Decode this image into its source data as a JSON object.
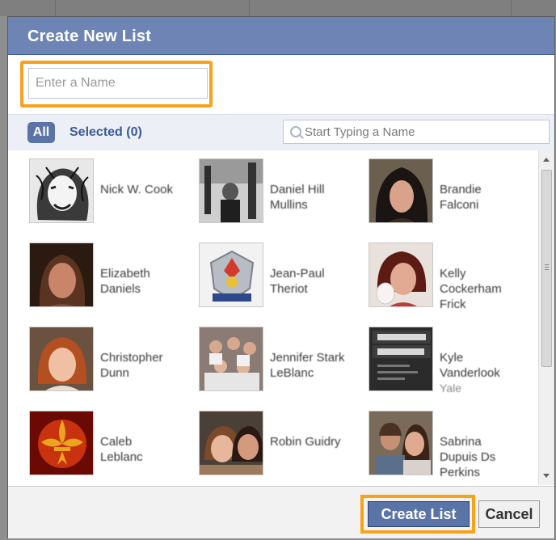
{
  "dialog": {
    "title": "Create New List",
    "name_placeholder": "Enter a Name",
    "name_value": ""
  },
  "filter": {
    "all_label": "All",
    "selected_label": "Selected (0)",
    "search_placeholder": "Start Typing a Name",
    "search_value": ""
  },
  "friends": [
    {
      "name": "Nick W. Cook",
      "network": ""
    },
    {
      "name": "Daniel Hill\nMullins",
      "network": ""
    },
    {
      "name": "Brandie\nFalconi",
      "network": ""
    },
    {
      "name": "Elizabeth\nDaniels",
      "network": ""
    },
    {
      "name": "Jean-Paul\nTheriot",
      "network": ""
    },
    {
      "name": "Kelly\nCockerham\nFrick",
      "network": ""
    },
    {
      "name": "Christopher\nDunn",
      "network": ""
    },
    {
      "name": "Jennifer Stark\nLeBlanc",
      "network": ""
    },
    {
      "name": "Kyle\nVanderlook",
      "network": "Yale"
    },
    {
      "name": "Caleb\nLeblanc",
      "network": ""
    },
    {
      "name": "Robin Guidry",
      "network": ""
    },
    {
      "name": "Sabrina\nDupuis Ds\nPerkins",
      "network": ""
    }
  ],
  "buttons": {
    "create_label": "Create List",
    "cancel_label": "Cancel"
  },
  "colors": {
    "titlebar": "#6d84b4",
    "accent": "#3b5998",
    "button": "#5b74a8",
    "highlight": "#f7a21b"
  },
  "icons": {
    "search": "magnifier-icon",
    "scroll_up": "arrow-up-icon",
    "scroll_down": "arrow-down-icon"
  }
}
